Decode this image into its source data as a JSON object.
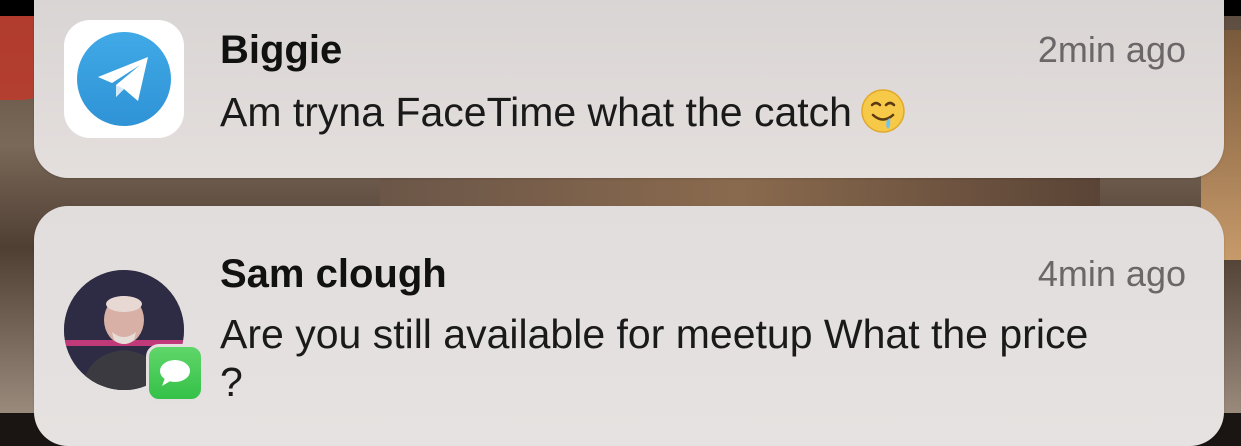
{
  "notifications": [
    {
      "app_icon": "telegram-icon",
      "sender": "Biggie",
      "time": "2min ago",
      "message": "Am tryna FaceTime what the catch",
      "emoji": "drooling-face-emoji"
    },
    {
      "app_icon": "messages-icon",
      "avatar": "contact-avatar",
      "sender": "Sam clough",
      "time": "4min ago",
      "message": "Are you still available for meetup What the price ?"
    }
  ],
  "colors": {
    "telegram_blue": "#2f93d6",
    "messages_green": "#34c148",
    "card_bg": "#e4dfdd",
    "timestamp_gray": "#6b6668"
  }
}
